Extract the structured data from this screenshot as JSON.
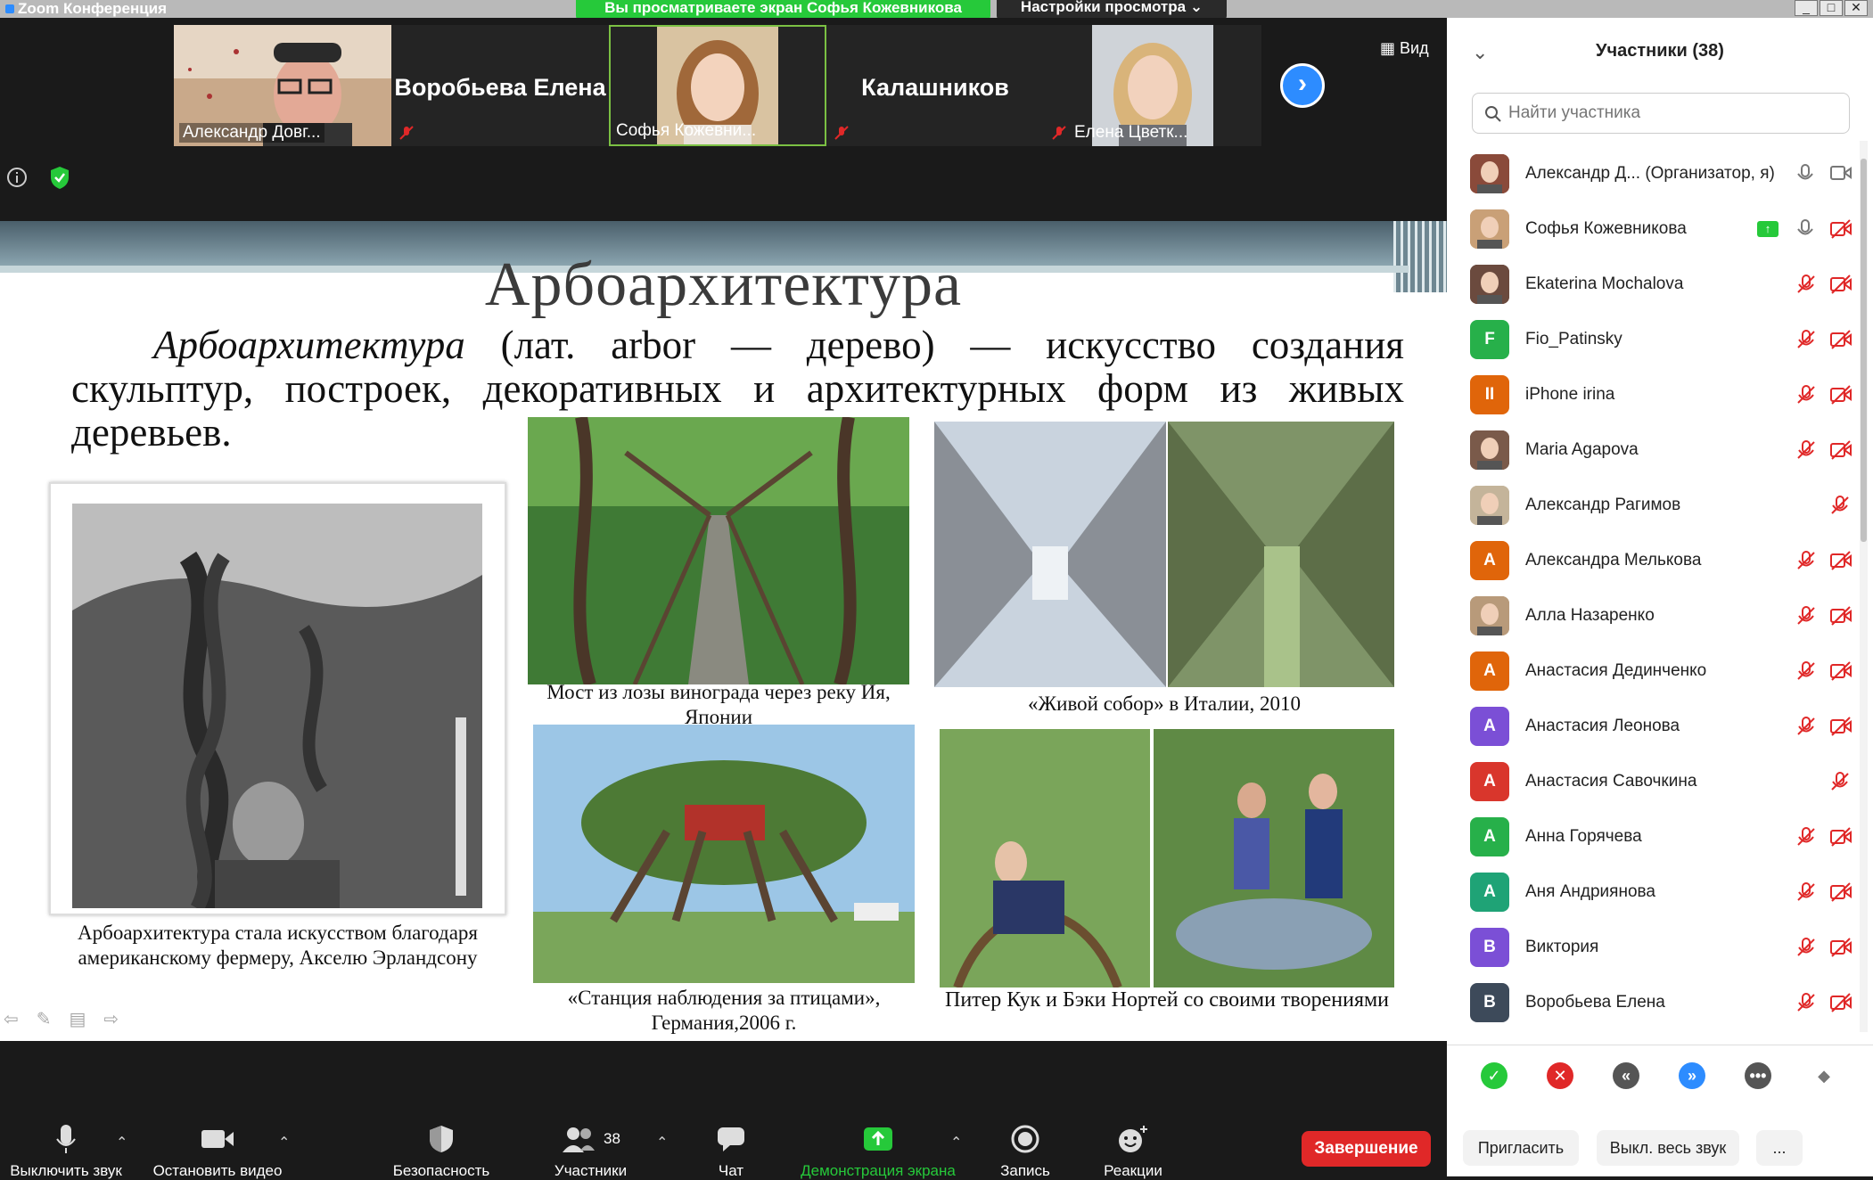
{
  "window": {
    "title": "Zoom Конференция",
    "share_banner": "Вы просматриваете экран Софья Кожевникова",
    "view_settings": "Настройки просмотра",
    "view_label": "Вид"
  },
  "strip": [
    {
      "name": "Александр Довг...",
      "type": "video"
    },
    {
      "name": "Воробьева Елена",
      "type": "name"
    },
    {
      "name": "Софья Кожевни...",
      "type": "video",
      "active": true
    },
    {
      "name": "Калашников",
      "type": "name"
    },
    {
      "name": "Елена Цветк...",
      "type": "video"
    }
  ],
  "slide": {
    "title": "Арбоархитектура",
    "def_italic": "Арбоархитектура",
    "def_rest": " (лат. arbor — дерево) — искусство создания скульптур, построек, декоративных и архитектурных форм из живых деревьев.",
    "captions": {
      "farmer": "Арбоархитектура стала искусством благодаря американскому фермеру, Акселю Эрландсону",
      "bridge": "Мост из лозы винограда через реку Ия, Японии",
      "cathedral": "«Живой собор» в Италии, 2010",
      "birds": "«Станция наблюдения за птицами», Германия,2006 г.",
      "peter": "Питер Кук и Бэки Нортей со своими творениями"
    }
  },
  "toolbar": {
    "mute": "Выключить звук",
    "video": "Остановить видео",
    "security": "Безопасность",
    "participants": "Участники",
    "participants_count": "38",
    "chat": "Чат",
    "share": "Демонстрация экрана",
    "record": "Запись",
    "reactions": "Реакции",
    "end": "Завершение"
  },
  "panel": {
    "title": "Участники (38)",
    "search_placeholder": "Найти участника",
    "participants": [
      {
        "name": "Александр Д...  (Организатор, я)",
        "avatar": "photo",
        "color": "#8a4a3a",
        "mic": "on",
        "cam": "on"
      },
      {
        "name": "Софья Кожевникова",
        "avatar": "photo",
        "color": "#c9a077",
        "mic": "on",
        "cam": "off",
        "sharing": true
      },
      {
        "name": "Ekaterina Mochalova",
        "avatar": "photo",
        "color": "#6b4a3e",
        "mic": "off",
        "cam": "off"
      },
      {
        "name": "Fio_Patinsky",
        "avatar": "F",
        "color": "#27b04a",
        "mic": "off",
        "cam": "off"
      },
      {
        "name": "iPhone irina",
        "avatar": "II",
        "color": "#e0650a",
        "mic": "off",
        "cam": "off"
      },
      {
        "name": "Maria Agapova",
        "avatar": "photo",
        "color": "#7a5a4a",
        "mic": "off",
        "cam": "off"
      },
      {
        "name": "Александр Рагимов",
        "avatar": "photo",
        "color": "#c4b49a",
        "mic": "off",
        "cam": "none"
      },
      {
        "name": "Александра Мелькова",
        "avatar": "А",
        "color": "#e0650a",
        "mic": "off",
        "cam": "off"
      },
      {
        "name": "Алла Назаренко",
        "avatar": "photo",
        "color": "#b89a7a",
        "mic": "off",
        "cam": "off"
      },
      {
        "name": "Анастасия Дединченко",
        "avatar": "А",
        "color": "#e0650a",
        "mic": "off",
        "cam": "off"
      },
      {
        "name": "Анастасия Леонова",
        "avatar": "А",
        "color": "#7b4fd6",
        "mic": "off",
        "cam": "off"
      },
      {
        "name": "Анастасия Савочкина",
        "avatar": "А",
        "color": "#d9362c",
        "mic": "off",
        "cam": "none"
      },
      {
        "name": "Анна Горячева",
        "avatar": "А",
        "color": "#27b04a",
        "mic": "off",
        "cam": "off"
      },
      {
        "name": "Аня Андриянова",
        "avatar": "А",
        "color": "#1fa376",
        "mic": "off",
        "cam": "off"
      },
      {
        "name": "Виктория",
        "avatar": "В",
        "color": "#7b4fd6",
        "mic": "off",
        "cam": "off"
      },
      {
        "name": "Воробьева Елена",
        "avatar": "В",
        "color": "#3d4a5a",
        "mic": "off",
        "cam": "off"
      }
    ],
    "invite": "Пригласить",
    "mute_all": "Выкл. весь звук",
    "more": "..."
  }
}
